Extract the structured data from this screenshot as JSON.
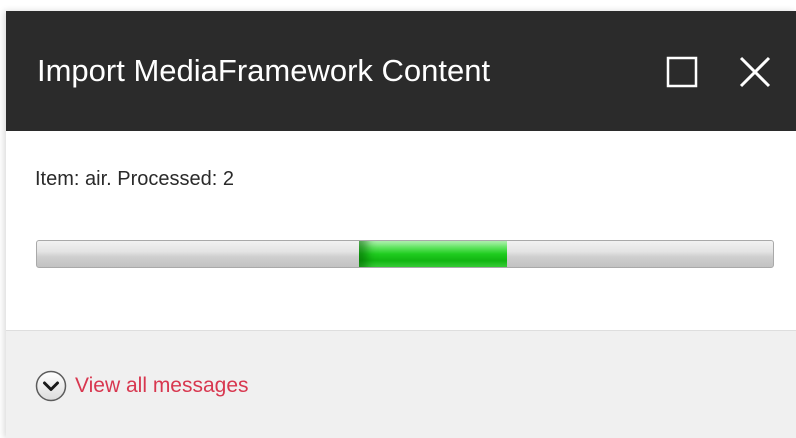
{
  "dialog": {
    "title": "Import MediaFramework Content",
    "maximize_icon": "maximize-icon",
    "close_icon": "close-icon"
  },
  "status": {
    "text": "Item: air. Processed: 2"
  },
  "progress": {
    "state": "indeterminate",
    "fill_color": "#1fcc1f"
  },
  "footer": {
    "toggle_icon": "chevron-down-circle-icon",
    "toggle_label": "View all messages",
    "link_color": "#d8374f"
  }
}
